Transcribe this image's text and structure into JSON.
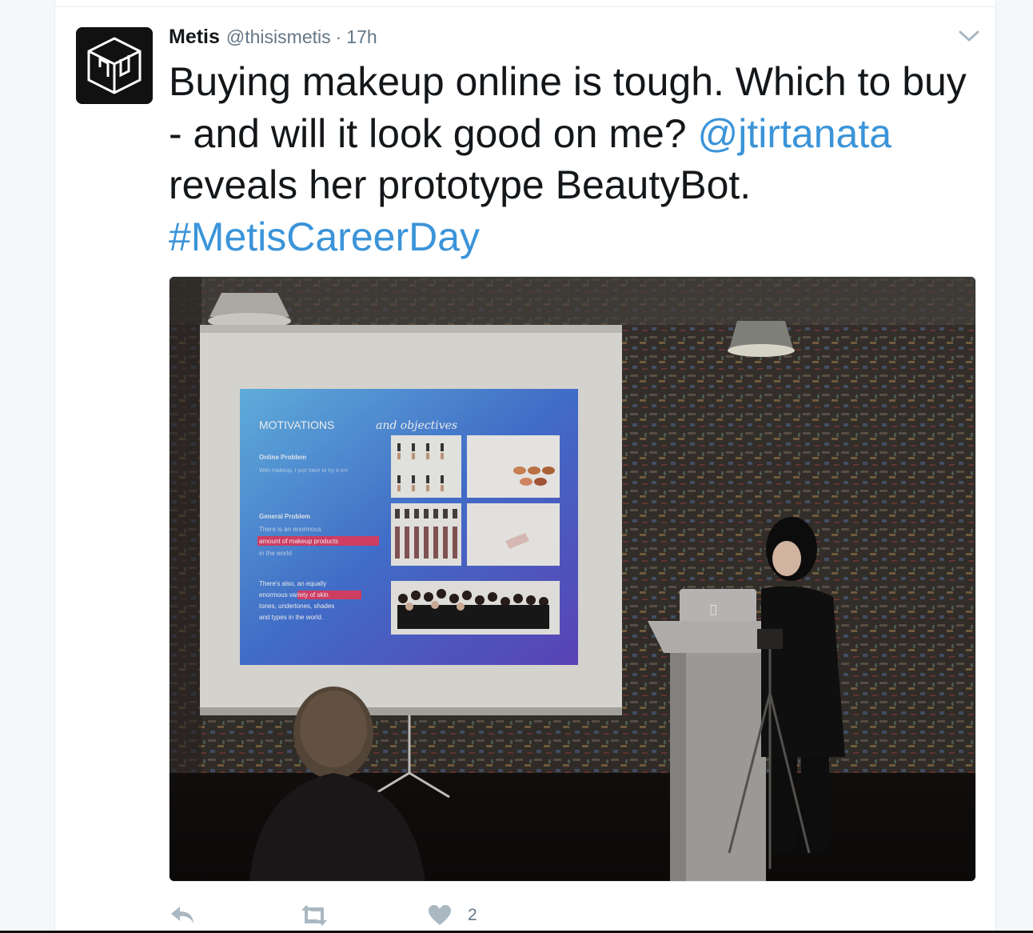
{
  "tweet": {
    "author": {
      "display_name": "Metis",
      "screen_name": "@thisismetis",
      "separator": "·",
      "timestamp": "17h",
      "avatar_icon": "metis-cube-logo"
    },
    "text": {
      "part1": "Buying makeup online is tough. Which to buy - and will it look good on me? ",
      "mention": "@jtirtanata",
      "part2": " reveals her prototype BeautyBot. ",
      "hashtag": "#MetisCareerDay"
    },
    "media": {
      "slide_title_a": "MOTIVATIONS",
      "slide_title_b": "and objectives",
      "slide_heading_1": "Online Problem",
      "slide_body_1": "With makeup, I just have to try it on!",
      "slide_heading_2": "General Problem",
      "slide_body_2a": "There is an enormous",
      "slide_body_2b": "amount of makeup products",
      "slide_body_2c": "in the world",
      "slide_body_3a": "There's also, an equally",
      "slide_body_3b": "enormous variety of skin",
      "slide_body_3c": "tones, undertones, shades",
      "slide_body_3d": "and types in the world."
    },
    "actions": {
      "reply_icon": "reply-icon",
      "retweet_icon": "retweet-icon",
      "like_icon": "heart-icon",
      "like_count": "2"
    },
    "colors": {
      "link": "#3b94d9",
      "text": "#14171a",
      "muted": "#657786"
    }
  }
}
